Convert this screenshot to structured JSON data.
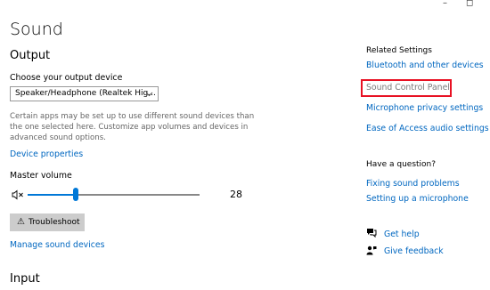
{
  "window": {
    "minimize_glyph": "–",
    "maximize_glyph": "◻"
  },
  "page": {
    "title": "Sound"
  },
  "output": {
    "heading": "Output",
    "device_label": "Choose your output device",
    "device_selected": "Speaker/Headphone (Realtek Hig...",
    "description": "Certain apps may be set up to use different sound devices than the one selected here. Customize app volumes and devices in advanced sound options.",
    "device_properties_link": "Device properties",
    "master_volume_label": "Master volume",
    "volume_value": "28",
    "volume_fraction": 0.28,
    "troubleshoot_label": "Troubleshoot",
    "manage_devices_link": "Manage sound devices"
  },
  "input": {
    "heading": "Input"
  },
  "related": {
    "heading": "Related Settings",
    "links": [
      "Bluetooth and other devices",
      "Sound Control Panel",
      "Microphone privacy settings",
      "Ease of Access audio settings"
    ]
  },
  "question": {
    "heading": "Have a question?",
    "links": [
      "Fixing sound problems",
      "Setting up a microphone"
    ]
  },
  "help": {
    "get_help": "Get help",
    "give_feedback": "Give feedback"
  },
  "icons": {
    "volume": "speaker-muted-icon",
    "troubleshoot": "warning-icon",
    "get_help": "chat-help-icon",
    "feedback": "person-feedback-icon",
    "dropdown": "chevron-down-icon"
  },
  "colors": {
    "link": "#0067c0",
    "accent": "#0078d7",
    "highlight": "#e81123"
  }
}
